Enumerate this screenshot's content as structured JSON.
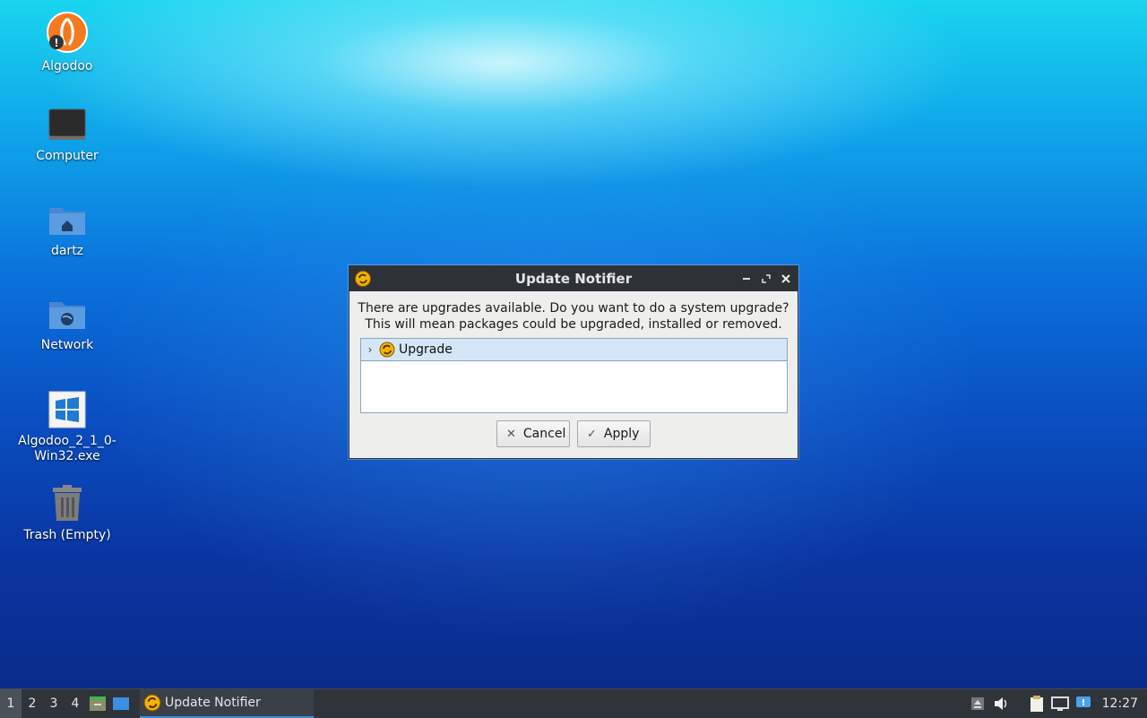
{
  "desktop": {
    "icons": [
      {
        "label": "Algodoo"
      },
      {
        "label": "Computer"
      },
      {
        "label": "dartz"
      },
      {
        "label": "Network"
      },
      {
        "label_line1": "Algodoo_2_1_0-",
        "label_line2": "Win32.exe"
      },
      {
        "label": "Trash (Empty)"
      }
    ]
  },
  "dialog": {
    "title": "Update Notifier",
    "message_line1": "There are upgrades available. Do you want to do a system upgrade?",
    "message_line2": "This will mean packages could be upgraded, installed or removed.",
    "tree_item": "Upgrade",
    "cancel_label": "Cancel",
    "apply_label": "Apply"
  },
  "taskbar": {
    "workspaces": [
      "1",
      "2",
      "3",
      "4"
    ],
    "active_workspace": "1",
    "task_label": "Update Notifier",
    "clock": "12:27"
  },
  "colors": {
    "titlebar": "#2d3237",
    "taskbar": "#2f343b",
    "selection": "#d5e6f6",
    "accent": "#3d8fd6"
  }
}
